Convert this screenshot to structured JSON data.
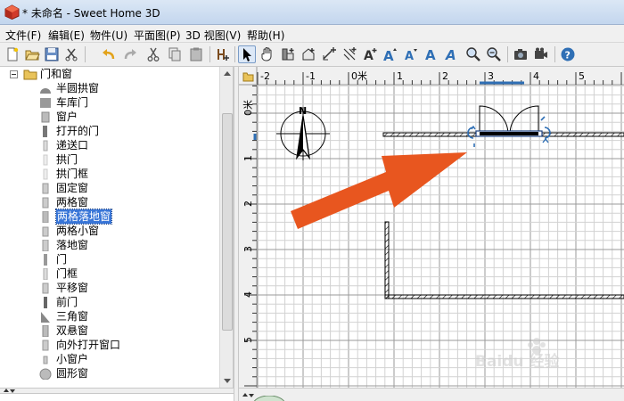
{
  "window": {
    "title": "* 未命名 - Sweet Home 3D"
  },
  "menu": [
    "文件(F)",
    "编辑(E)",
    "物件(U)",
    "平面图(P)",
    "3D 视图(V)",
    "帮助(H)"
  ],
  "toolbar": {
    "buttons": [
      "new-icon",
      "open-icon",
      "save-icon",
      "cut-tool-icon",
      "undo-icon",
      "redo-icon",
      "cut-icon",
      "copy-icon",
      "paste-icon",
      "add-furniture-icon",
      "select-icon",
      "pan-icon",
      "create-walls-icon",
      "create-rooms-icon",
      "create-dimensions-icon",
      "create-labels-icon",
      "add-text-icon",
      "increase-text-icon",
      "decrease-text-icon",
      "bold-icon",
      "italic-icon",
      "zoom-in-icon",
      "zoom-out-icon",
      "photo-icon",
      "video-icon",
      "help-icon"
    ],
    "active": "select-icon"
  },
  "tree": {
    "category": "门和窗",
    "items": [
      "半圆拱窗",
      "车库门",
      "窗户",
      "打开的门",
      "递送口",
      "拱门",
      "拱门框",
      "固定窗",
      "两格窗",
      "两格落地窗",
      "两格小窗",
      "落地窗",
      "门",
      "门框",
      "平移窗",
      "前门",
      "三角窗",
      "双悬窗",
      "向外打开窗口",
      "小窗户",
      "圆形窗"
    ],
    "selected": "两格落地窗"
  },
  "plan": {
    "ruler_x_labels": [
      "-2",
      "-1",
      "0米",
      "1",
      "2",
      "3",
      "4",
      "5",
      "6"
    ],
    "ruler_y_labels": [
      "0米",
      "1",
      "2",
      "3",
      "4",
      "5"
    ],
    "compass_letter": "N"
  },
  "watermark": "Baidu 经验"
}
